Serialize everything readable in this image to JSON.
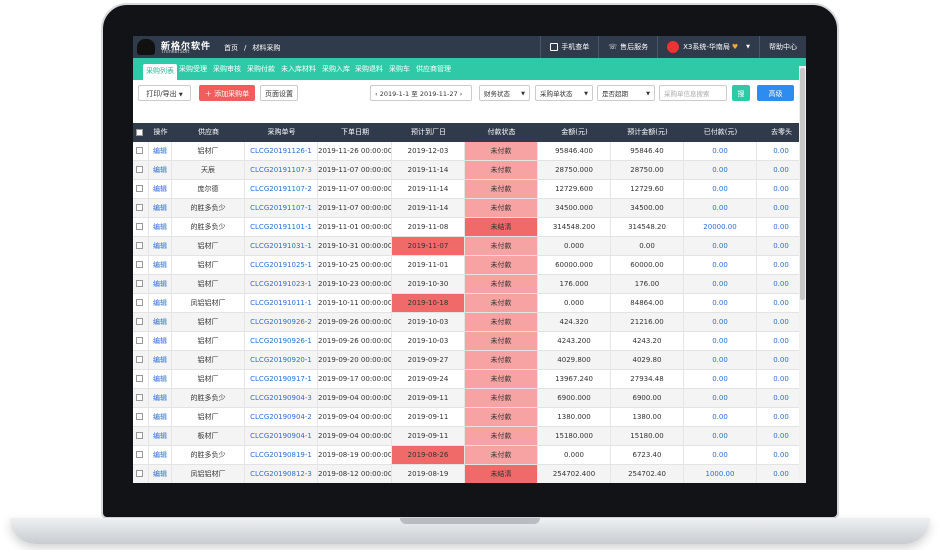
{
  "header": {
    "brand": "新格尔软件",
    "brand_sub": "ThinkerSoft",
    "breadcrumb": [
      "首页",
      "/",
      "材料采购"
    ],
    "mobile_order": "手机查单",
    "after_sales": "售后服务",
    "user": "X3系统-华南局",
    "help": "帮助中心"
  },
  "tabs": [
    "采购列表",
    "采购受理",
    "采购审核",
    "采购付款",
    "未入库材料",
    "采购入库",
    "采购退料",
    "采购车",
    "供应商管理"
  ],
  "toolbar": {
    "print_export": "打印/导出",
    "add_order": "添加采购单",
    "page_settings": "页面设置",
    "date_range": "2019-1-1 至 2019-11-27",
    "finance_status": "财务状态",
    "order_status": "采购单状态",
    "overdue": "是否超期",
    "search_placeholder": "采购单信息搜索",
    "search_btn": "搜",
    "advanced": "高级"
  },
  "columns": [
    "操作",
    "供应商",
    "采购单号",
    "下单日期",
    "预计到厂日",
    "付款状态",
    "金额(元)",
    "预计金额(元)",
    "已付款(元)",
    "去零头"
  ],
  "rows": [
    {
      "op": "编辑",
      "supplier": "铝材厂",
      "order": "CLCG20191126-1",
      "date": "2019-11-26 00:00:00",
      "eta": "2019-12-03",
      "pay": "未付款",
      "amount": "95846.400",
      "est": "95846.40",
      "paid": "0.00",
      "round": "0.00",
      "late": false,
      "partial": false
    },
    {
      "op": "编辑",
      "supplier": "天辰",
      "order": "CLCG20191107-3",
      "date": "2019-11-07 00:00:00",
      "eta": "2019-11-14",
      "pay": "未付款",
      "amount": "28750.000",
      "est": "28750.00",
      "paid": "0.00",
      "round": "0.00",
      "late": false,
      "partial": false
    },
    {
      "op": "编辑",
      "supplier": "庞尔德",
      "order": "CLCG20191107-2",
      "date": "2019-11-07 00:00:00",
      "eta": "2019-11-14",
      "pay": "未付款",
      "amount": "12729.600",
      "est": "12729.60",
      "paid": "0.00",
      "round": "0.00",
      "late": false,
      "partial": false
    },
    {
      "op": "编辑",
      "supplier": "的胜多负少",
      "order": "CLCG20191107-1",
      "date": "2019-11-07 00:00:00",
      "eta": "2019-11-14",
      "pay": "未付款",
      "amount": "34500.000",
      "est": "34500.00",
      "paid": "0.00",
      "round": "0.00",
      "late": false,
      "partial": false
    },
    {
      "op": "编辑",
      "supplier": "的胜多负少",
      "order": "CLCG20191101-1",
      "date": "2019-11-01 00:00:00",
      "eta": "2019-11-08",
      "pay": "未结清",
      "amount": "314548.200",
      "est": "314548.20",
      "paid": "20000.00",
      "round": "0.00",
      "late": false,
      "partial": true
    },
    {
      "op": "编辑",
      "supplier": "铝材厂",
      "order": "CLCG20191031-1",
      "date": "2019-10-31 00:00:00",
      "eta": "2019-11-07",
      "pay": "未付款",
      "amount": "0.000",
      "est": "0.00",
      "paid": "0.00",
      "round": "0.00",
      "late": true,
      "partial": false
    },
    {
      "op": "编辑",
      "supplier": "铝材厂",
      "order": "CLCG20191025-1",
      "date": "2019-10-25 00:00:00",
      "eta": "2019-11-01",
      "pay": "未付款",
      "amount": "60000.000",
      "est": "60000.00",
      "paid": "0.00",
      "round": "0.00",
      "late": false,
      "partial": false
    },
    {
      "op": "编辑",
      "supplier": "铝材厂",
      "order": "CLCG20191023-1",
      "date": "2019-10-23 00:00:00",
      "eta": "2019-10-30",
      "pay": "未付款",
      "amount": "176.000",
      "est": "176.00",
      "paid": "0.00",
      "round": "0.00",
      "late": false,
      "partial": false
    },
    {
      "op": "编辑",
      "supplier": "凤铝铝材厂",
      "order": "CLCG20191011-1",
      "date": "2019-10-11 00:00:00",
      "eta": "2019-10-18",
      "pay": "未付款",
      "amount": "0.000",
      "est": "84864.00",
      "paid": "0.00",
      "round": "0.00",
      "late": true,
      "partial": false
    },
    {
      "op": "编辑",
      "supplier": "铝材厂",
      "order": "CLCG20190926-2",
      "date": "2019-09-26 00:00:00",
      "eta": "2019-10-03",
      "pay": "未付款",
      "amount": "424.320",
      "est": "21216.00",
      "paid": "0.00",
      "round": "0.00",
      "late": false,
      "partial": false
    },
    {
      "op": "编辑",
      "supplier": "铝材厂",
      "order": "CLCG20190926-1",
      "date": "2019-09-26 00:00:00",
      "eta": "2019-10-03",
      "pay": "未付款",
      "amount": "4243.200",
      "est": "4243.20",
      "paid": "0.00",
      "round": "0.00",
      "late": false,
      "partial": false
    },
    {
      "op": "编辑",
      "supplier": "铝材厂",
      "order": "CLCG20190920-1",
      "date": "2019-09-20 00:00:00",
      "eta": "2019-09-27",
      "pay": "未付款",
      "amount": "4029.800",
      "est": "4029.80",
      "paid": "0.00",
      "round": "0.00",
      "late": false,
      "partial": false
    },
    {
      "op": "编辑",
      "supplier": "铝材厂",
      "order": "CLCG20190917-1",
      "date": "2019-09-17 00:00:00",
      "eta": "2019-09-24",
      "pay": "未付款",
      "amount": "13967.240",
      "est": "27934.48",
      "paid": "0.00",
      "round": "0.00",
      "late": false,
      "partial": false
    },
    {
      "op": "编辑",
      "supplier": "的胜多负少",
      "order": "CLCG20190904-3",
      "date": "2019-09-04 00:00:00",
      "eta": "2019-09-11",
      "pay": "未付款",
      "amount": "6900.000",
      "est": "6900.00",
      "paid": "0.00",
      "round": "0.00",
      "late": false,
      "partial": false
    },
    {
      "op": "编辑",
      "supplier": "铝材厂",
      "order": "CLCG20190904-2",
      "date": "2019-09-04 00:00:00",
      "eta": "2019-09-11",
      "pay": "未付款",
      "amount": "1380.000",
      "est": "1380.00",
      "paid": "0.00",
      "round": "0.00",
      "late": false,
      "partial": false
    },
    {
      "op": "编辑",
      "supplier": "板材厂",
      "order": "CLCG20190904-1",
      "date": "2019-09-04 00:00:00",
      "eta": "2019-09-11",
      "pay": "未付款",
      "amount": "15180.000",
      "est": "15180.00",
      "paid": "0.00",
      "round": "0.00",
      "late": false,
      "partial": false
    },
    {
      "op": "编辑",
      "supplier": "的胜多负少",
      "order": "CLCG20190819-1",
      "date": "2019-08-19 00:00:00",
      "eta": "2019-08-26",
      "pay": "未付款",
      "amount": "0.000",
      "est": "6723.40",
      "paid": "0.00",
      "round": "0.00",
      "late": true,
      "partial": false
    },
    {
      "op": "编辑",
      "supplier": "凤铝铝材厂",
      "order": "CLCG20190812-3",
      "date": "2019-08-12 00:00:00",
      "eta": "2019-08-19",
      "pay": "未结清",
      "amount": "254702.400",
      "est": "254702.40",
      "paid": "1000.00",
      "round": "0.00",
      "late": false,
      "partial": true
    }
  ],
  "colors": {
    "header": "#2f3a4a",
    "tab_bar": "#30c9a8",
    "unpaid": "#f7a3a3",
    "overdue": "#f06a6a",
    "link": "#2d6fd0"
  }
}
